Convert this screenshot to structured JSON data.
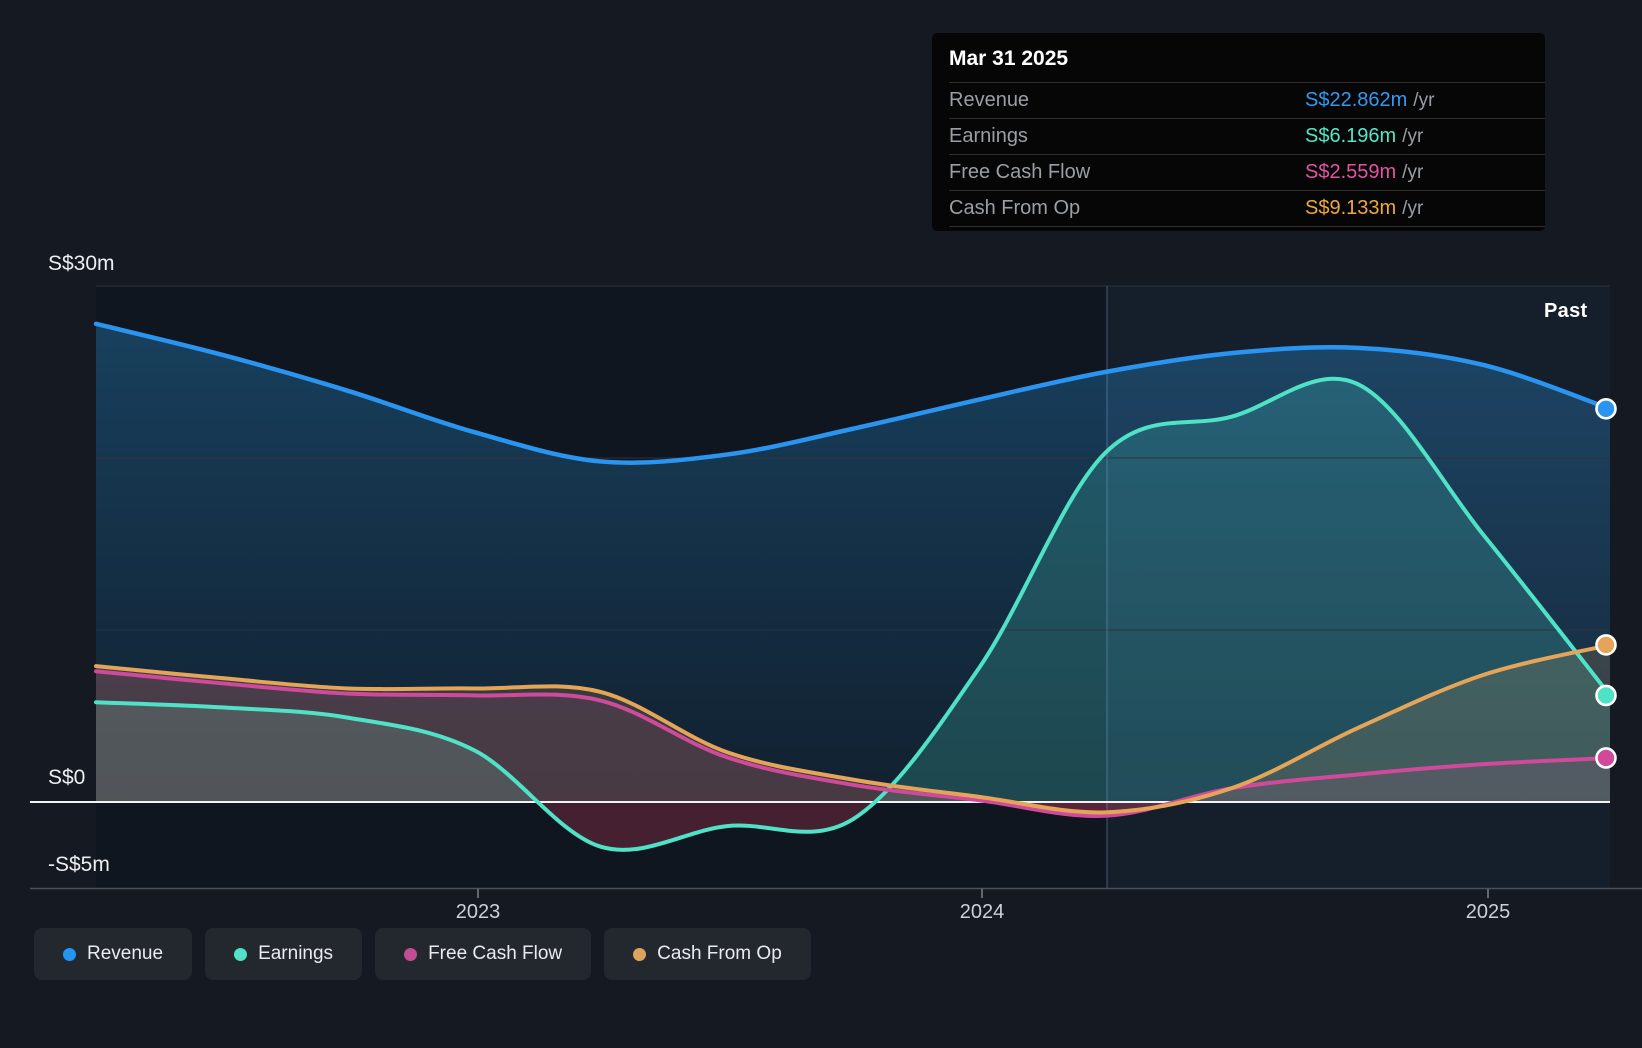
{
  "tooltip": {
    "title": "Mar 31 2025",
    "rows": [
      {
        "label": "Revenue",
        "value": "S$22.862m",
        "unit": "/yr",
        "color": "#2e9bf5"
      },
      {
        "label": "Earnings",
        "value": "S$6.196m",
        "unit": "/yr",
        "color": "#55e6c9"
      },
      {
        "label": "Free Cash Flow",
        "value": "S$2.559m",
        "unit": "/yr",
        "color": "#e553a3"
      },
      {
        "label": "Cash From Op",
        "value": "S$9.133m",
        "unit": "/yr",
        "color": "#eda93f"
      }
    ]
  },
  "past_label": "Past",
  "axis": {
    "y_labels": [
      {
        "text": "S$30m",
        "value": 30
      },
      {
        "text": "S$0",
        "value": 0
      },
      {
        "text": "-S$5m",
        "value": -5
      }
    ],
    "x_labels": [
      "2023",
      "2024",
      "2025"
    ]
  },
  "legend": [
    {
      "label": "Revenue",
      "color": "#2196f3"
    },
    {
      "label": "Earnings",
      "color": "#52e0c6"
    },
    {
      "label": "Free Cash Flow",
      "color": "#c24d93"
    },
    {
      "label": "Cash From Op",
      "color": "#dda35d"
    }
  ],
  "chart_data": {
    "type": "area",
    "title": "",
    "unit": "S$m",
    "ylim": [
      -5,
      30
    ],
    "y_gridlines": [
      30,
      20,
      10,
      0
    ],
    "grid": true,
    "legend_position": "bottom",
    "x": [
      "2022-03-31",
      "2022-06-30",
      "2022-09-30",
      "2022-12-31",
      "2023-03-31",
      "2023-06-30",
      "2023-09-30",
      "2023-12-31",
      "2024-03-31",
      "2024-06-30",
      "2024-09-30",
      "2024-12-31",
      "2025-03-31"
    ],
    "x_tick_labels": [
      "2023",
      "2024",
      "2025"
    ],
    "past_period_start": "2024-03-31",
    "series": [
      {
        "name": "Revenue",
        "color": "#2a95f0",
        "values": [
          27.8,
          26.0,
          23.9,
          21.5,
          19.8,
          20.2,
          21.7,
          23.4,
          25.0,
          26.1,
          26.4,
          25.4,
          22.862
        ]
      },
      {
        "name": "Earnings",
        "color": "#4fe2c7",
        "values": [
          5.8,
          5.5,
          4.9,
          3.0,
          -2.6,
          -1.4,
          -1.0,
          7.8,
          20.3,
          22.4,
          24.3,
          15.5,
          6.196
        ]
      },
      {
        "name": "Free Cash Flow",
        "color": "#cf4a9b",
        "values": [
          7.6,
          6.9,
          6.3,
          6.2,
          5.9,
          2.6,
          1.0,
          0.1,
          -0.8,
          0.8,
          1.6,
          2.2,
          2.559
        ]
      },
      {
        "name": "Cash From Op",
        "color": "#e5a558",
        "values": [
          7.9,
          7.2,
          6.6,
          6.6,
          6.4,
          2.9,
          1.3,
          0.3,
          -0.6,
          0.8,
          4.3,
          7.4,
          9.133
        ]
      }
    ]
  }
}
